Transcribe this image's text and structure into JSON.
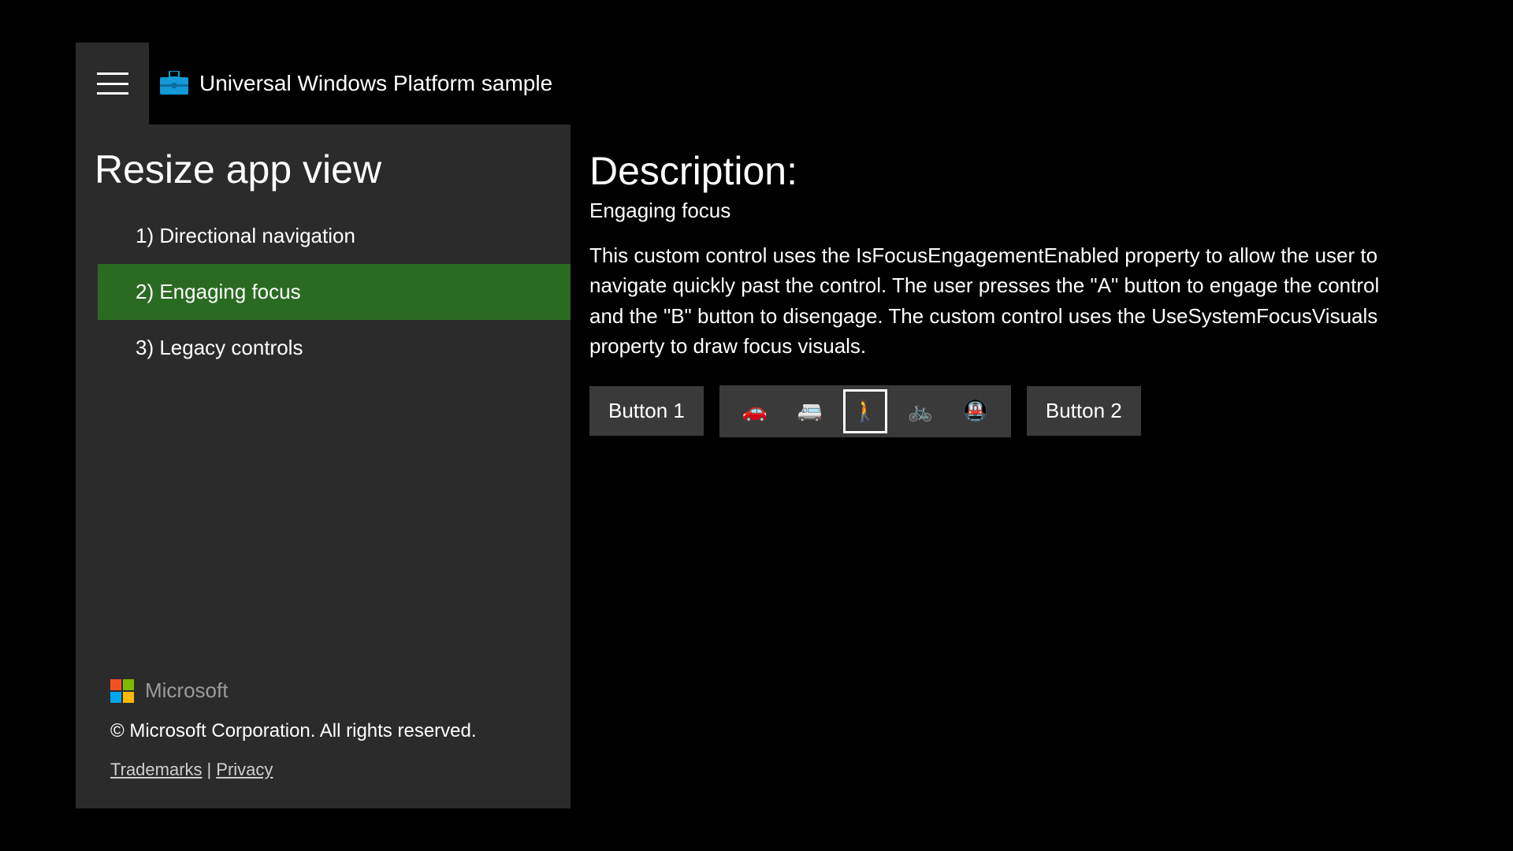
{
  "header": {
    "title": "Universal Windows Platform sample"
  },
  "sidebar": {
    "title": "Resize app view",
    "items": [
      {
        "label": "1) Directional navigation",
        "selected": false
      },
      {
        "label": "2) Engaging focus",
        "selected": true
      },
      {
        "label": "3) Legacy controls",
        "selected": false
      }
    ],
    "footer": {
      "vendor": "Microsoft",
      "copyright": "© Microsoft Corporation. All rights reserved.",
      "links": {
        "trademarks": "Trademarks",
        "privacy": "Privacy"
      }
    }
  },
  "main": {
    "heading": "Description:",
    "subheading": "Engaging focus",
    "body": "This custom control uses the IsFocusEngagementEnabled property to allow the user to navigate quickly past the control. The user presses the \"A\" button to engage the control and the \"B\" button to disengage. The custom control uses the UseSystemFocusVisuals property to draw focus visuals.",
    "button1": "Button 1",
    "button2": "Button 2",
    "control_items": [
      {
        "glyph": "🚗",
        "name": "car-icon",
        "focused": false
      },
      {
        "glyph": "🚐",
        "name": "van-icon",
        "focused": false
      },
      {
        "glyph": "🚶",
        "name": "pedestrian-icon",
        "focused": true
      },
      {
        "glyph": "🚲",
        "name": "bicycle-icon",
        "focused": false
      },
      {
        "glyph": "🚇",
        "name": "metro-icon",
        "focused": false
      }
    ]
  }
}
